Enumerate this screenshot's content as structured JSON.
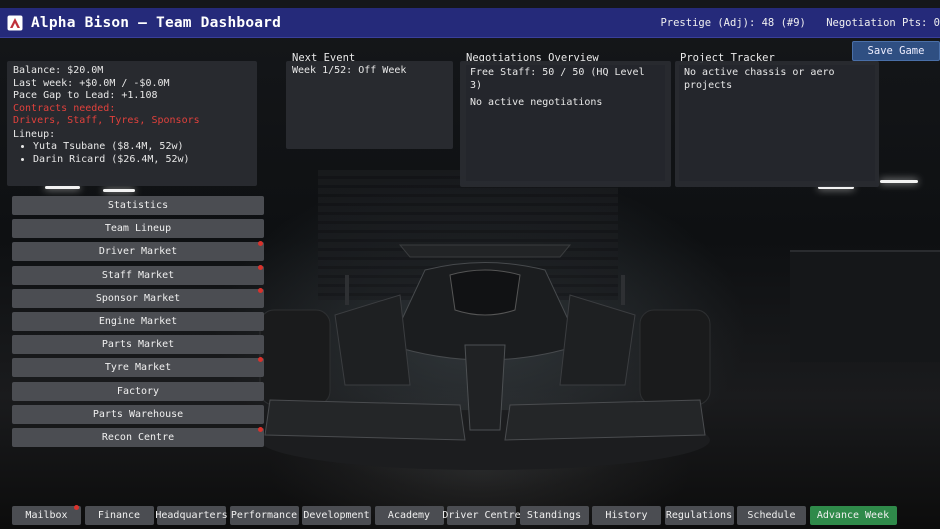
{
  "header": {
    "title": "Alpha Bison — Team Dashboard",
    "prestige": "Prestige (Adj): 48 (#9)",
    "negotiation_pts": "Negotiation Pts: 0",
    "save_label": "Save Game"
  },
  "finance": {
    "balance": "Balance: $20.0M",
    "last_week": "Last week: +$0.0M / -$0.0M",
    "pace_gap": "Pace Gap to Lead: +1.108",
    "contracts_label": "Contracts needed:",
    "contracts_list": "Drivers, Staff, Tyres, Sponsors",
    "lineup_label": "Lineup:",
    "lineup": [
      "Yuta Tsubane ($8.4M, 52w)",
      "Darin Ricard ($26.4M, 52w)"
    ]
  },
  "next_event": {
    "title": "Next Event",
    "text": "Week 1/52: Off Week"
  },
  "negotiations": {
    "title": "Negotiations Overview",
    "free_staff": "Free Staff: 50 / 50  (HQ Level 3)",
    "status": "No active negotiations"
  },
  "projects": {
    "title": "Project Tracker",
    "status": "No active chassis or aero projects"
  },
  "side_menu": [
    {
      "label": "Statistics",
      "alert": false
    },
    {
      "label": "Team Lineup",
      "alert": false
    },
    {
      "label": "Driver Market",
      "alert": true
    },
    {
      "label": "Staff Market",
      "alert": true
    },
    {
      "label": "Sponsor Market",
      "alert": true
    },
    {
      "label": "Engine Market",
      "alert": false
    },
    {
      "label": "Parts Market",
      "alert": false
    },
    {
      "label": "Tyre Market",
      "alert": true
    },
    {
      "label": "Factory",
      "alert": false
    },
    {
      "label": "Parts Warehouse",
      "alert": false
    },
    {
      "label": "Recon Centre",
      "alert": true
    }
  ],
  "bottom_tabs": [
    {
      "label": "Mailbox",
      "alert": true
    },
    {
      "label": "Finance",
      "alert": false
    },
    {
      "label": "Headquarters",
      "alert": false
    },
    {
      "label": "Performance",
      "alert": false
    },
    {
      "label": "Development",
      "alert": false
    },
    {
      "label": "Academy",
      "alert": false
    },
    {
      "label": "Driver Centre",
      "alert": false
    },
    {
      "label": "Standings",
      "alert": false
    },
    {
      "label": "History",
      "alert": false
    },
    {
      "label": "Regulations",
      "alert": false
    },
    {
      "label": "Schedule",
      "alert": false
    }
  ],
  "advance_label": "Advance Week",
  "colors": {
    "titlebar": "#252a7a",
    "alert": "#d8322c",
    "advance": "#2f8a4a",
    "button": "#4b4d52"
  }
}
